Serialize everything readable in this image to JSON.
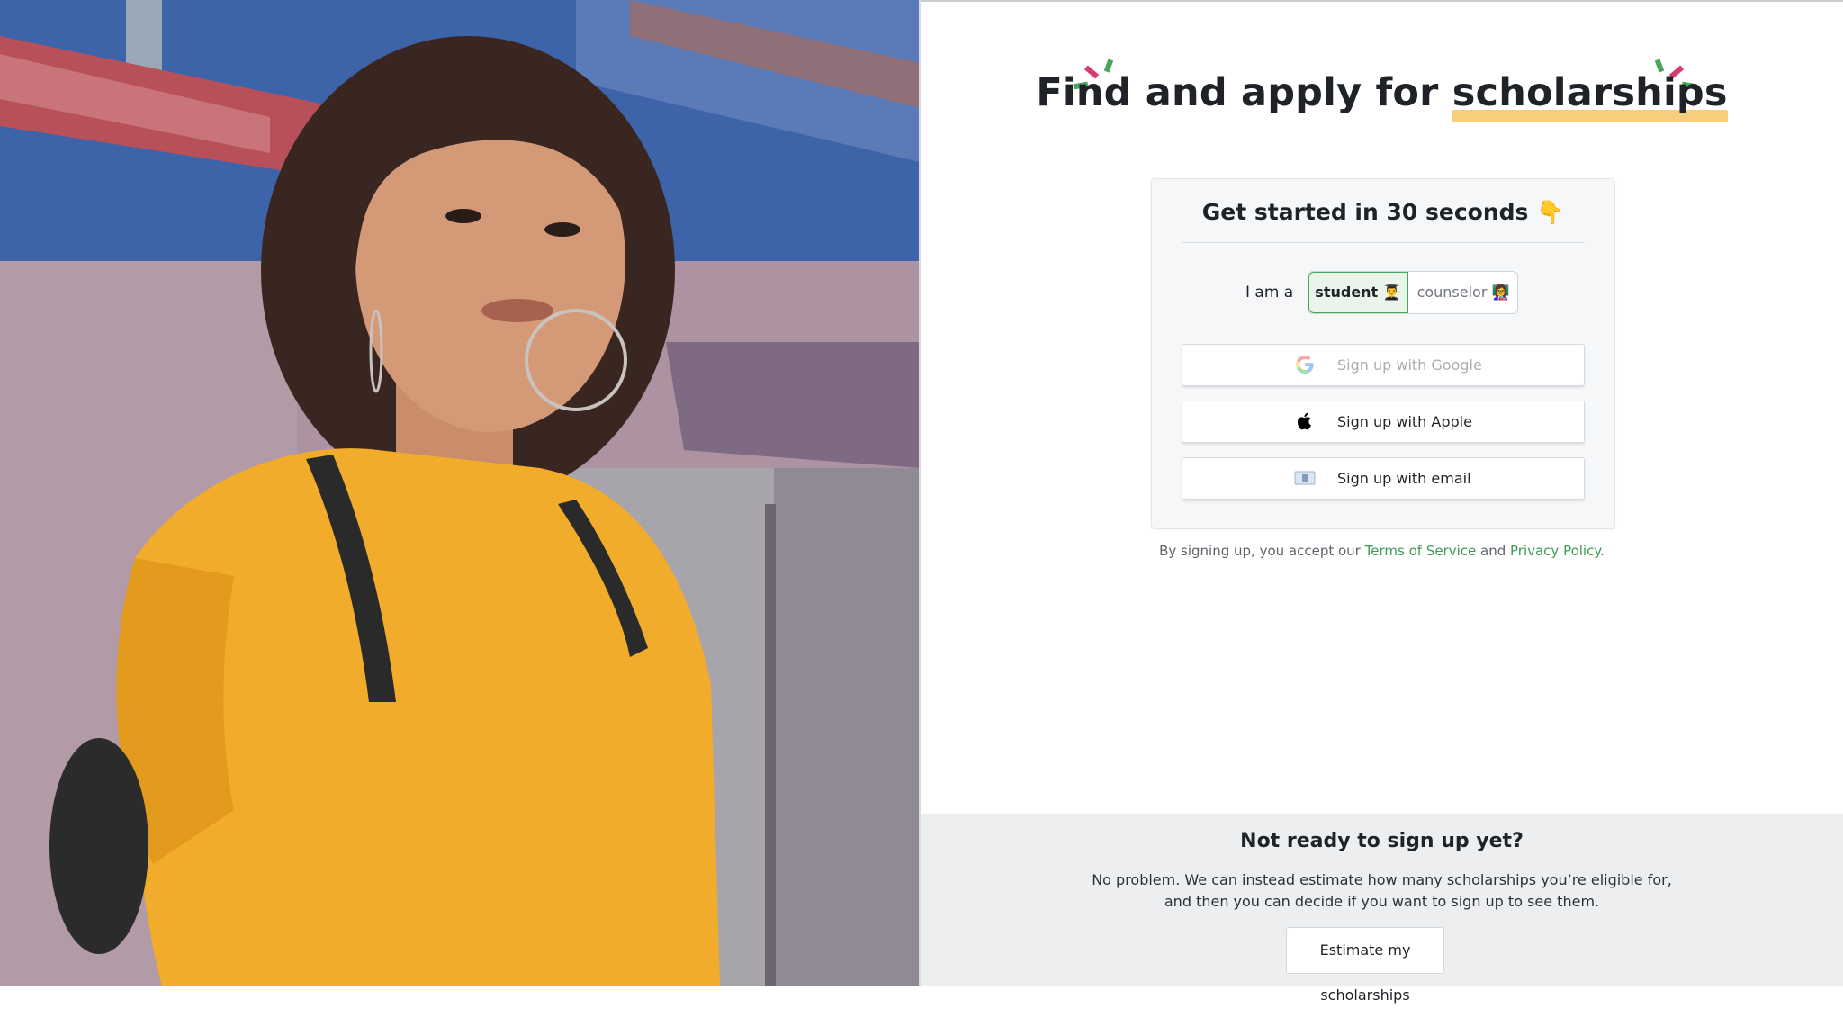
{
  "headline": {
    "text_before": "Find and apply for ",
    "highlight": "scholarships"
  },
  "signup_card": {
    "title": "Get started in 30 seconds 👇",
    "role_label": "I am a",
    "roles": [
      {
        "label": "student 👨‍🎓",
        "selected": true
      },
      {
        "label": "counselor 👩‍🏫",
        "selected": false
      }
    ],
    "buttons": {
      "google": "Sign up with Google",
      "apple": "Sign up with Apple",
      "email": "Sign up with email"
    }
  },
  "terms": {
    "prefix": "By signing up, you accept our ",
    "terms_link": "Terms of Service",
    "middle": " and ",
    "privacy_link": "Privacy Policy",
    "suffix": "."
  },
  "not_ready": {
    "title": "Not ready to sign up yet?",
    "line1": "No problem. We can instead estimate how many scholarships you’re eligible for,",
    "line2": "and then you can decide if you want to sign up to see them.",
    "button": "Estimate my scholarships"
  },
  "colors": {
    "accent_green": "#4aa65a",
    "highlight_yellow": "#f7cf7c",
    "sparkle_pink": "#d63b6b",
    "link_green": "#3e9a55"
  },
  "icons": [
    "google-icon",
    "apple-icon",
    "email-icon",
    "sparkle-icon"
  ]
}
